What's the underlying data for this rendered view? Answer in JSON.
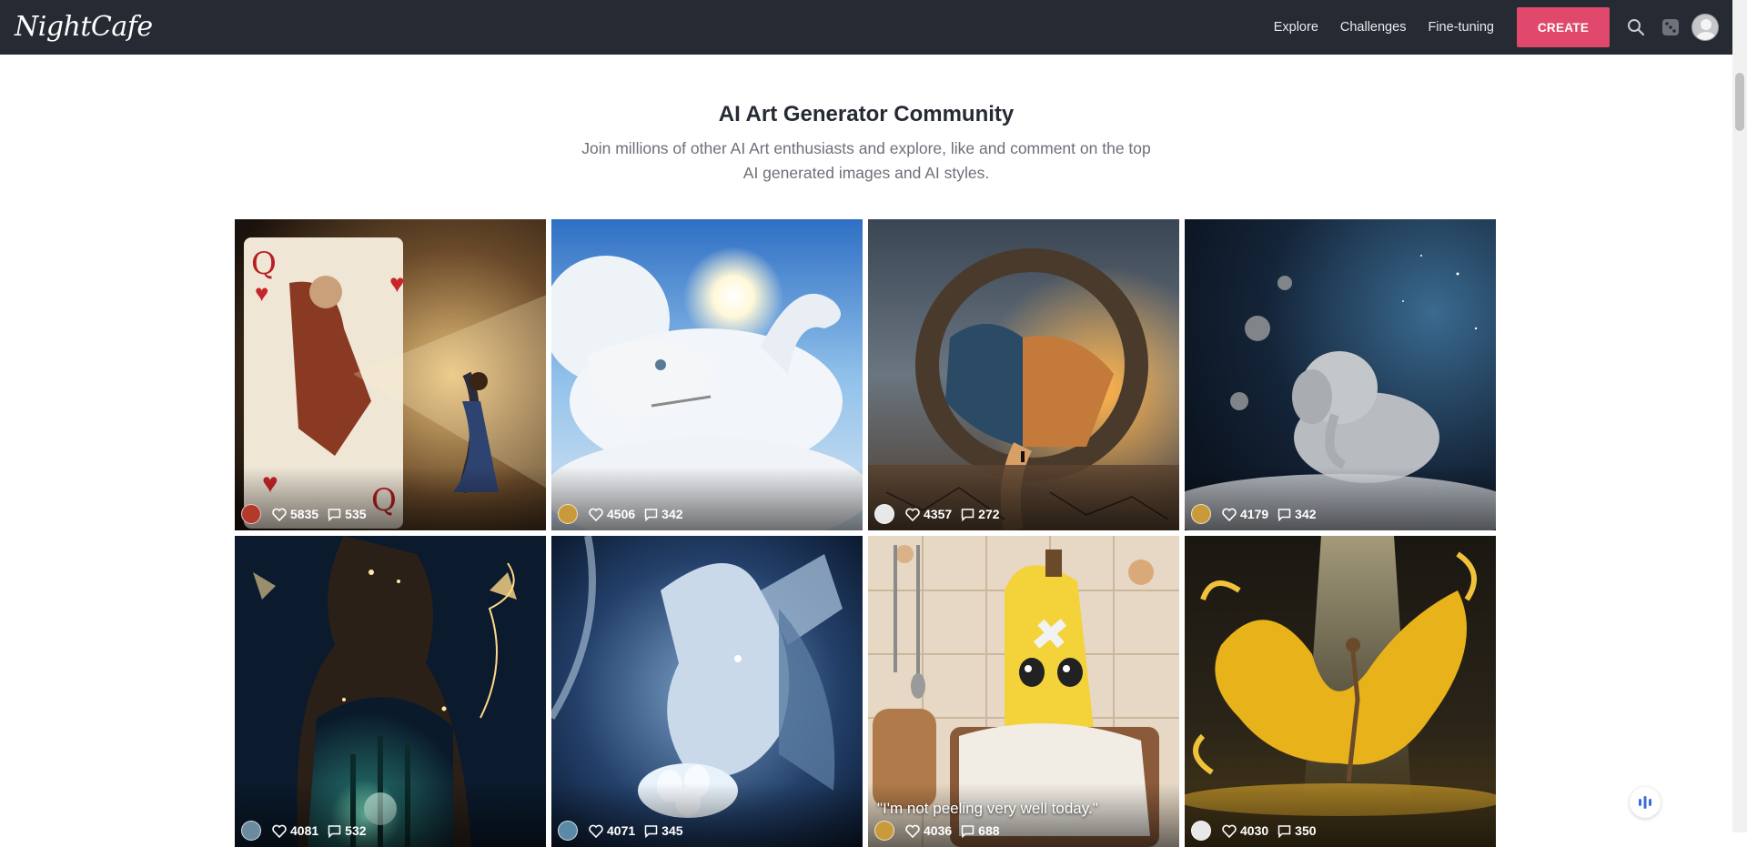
{
  "navbar": {
    "logo": "NightCafe",
    "links": [
      "Explore",
      "Challenges",
      "Fine-tuning"
    ],
    "create_label": "CREATE",
    "icons": [
      "search-icon",
      "dice-icon",
      "user-avatar"
    ]
  },
  "hero": {
    "title": "AI Art Generator Community",
    "subtitle": "Join millions of other AI Art enthusiasts and explore, like and comment on the top AI generated images and AI styles."
  },
  "creations": [
    {
      "likes": "5835",
      "comments": "535",
      "caption": "",
      "subject": "queen of hearts card reaching to a girl"
    },
    {
      "likes": "4506",
      "comments": "342",
      "caption": "",
      "subject": "cloud dinosaur under sun"
    },
    {
      "likes": "4357",
      "comments": "272",
      "caption": "",
      "subject": "ring portal between ocean and desert"
    },
    {
      "likes": "4179",
      "comments": "342",
      "caption": "",
      "subject": "baby elephant sleeping on crescent moon"
    },
    {
      "likes": "4081",
      "comments": "532",
      "caption": "",
      "subject": "woman with glowing forest and butterflies"
    },
    {
      "likes": "4071",
      "comments": "345",
      "caption": "",
      "subject": "ice dragon holding eggs"
    },
    {
      "likes": "4036",
      "comments": "688",
      "caption": "\"I'm not peeling very well today.\"",
      "subject": "sick banana in bed"
    },
    {
      "likes": "4030",
      "comments": "350",
      "caption": "",
      "subject": "golden ballet dancer splash"
    }
  ],
  "colors": {
    "navbar": "#262a33",
    "accent": "#e0496b"
  }
}
